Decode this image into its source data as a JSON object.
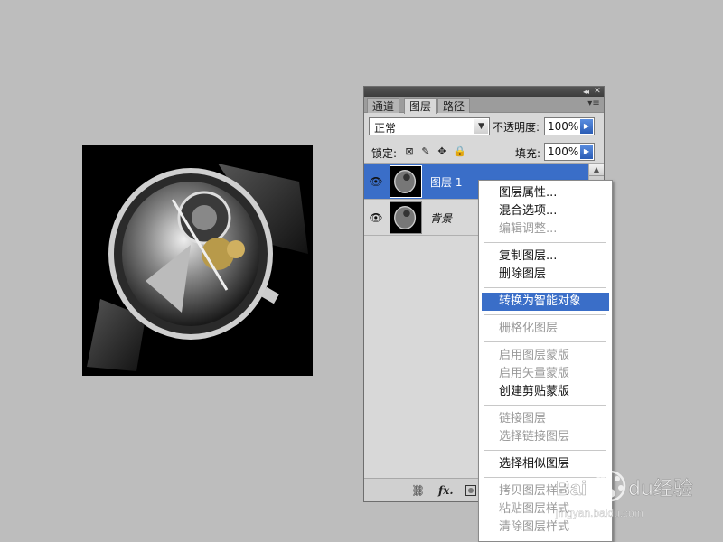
{
  "panel": {
    "collapse_glyph": "◂◂",
    "close_glyph": "✕",
    "tabs": [
      {
        "label": "通道"
      },
      {
        "label": "图层"
      },
      {
        "label": "路径"
      }
    ],
    "menu_icon_glyph": "▾≡",
    "blend_mode": "正常",
    "opacity_label": "不透明度:",
    "opacity_value": "100%",
    "lock_label": "锁定:",
    "fill_label": "填充:",
    "fill_value": "100%",
    "layers": [
      {
        "name": "图层 1",
        "selected": true,
        "visible": true
      },
      {
        "name": "背景",
        "selected": false,
        "visible": true
      }
    ],
    "footer_fx": "fx."
  },
  "context_menu": {
    "items": [
      {
        "label": "图层属性...",
        "enabled": true
      },
      {
        "label": "混合选项...",
        "enabled": true
      },
      {
        "label": "编辑调整...",
        "enabled": false
      },
      {
        "label": "复制图层...",
        "enabled": true
      },
      {
        "label": "删除图层",
        "enabled": true
      },
      {
        "label": "转换为智能对象",
        "enabled": true,
        "highlighted": true
      },
      {
        "label": "栅格化图层",
        "enabled": false
      },
      {
        "label": "启用图层蒙版",
        "enabled": false
      },
      {
        "label": "启用矢量蒙版",
        "enabled": false
      },
      {
        "label": "创建剪贴蒙版",
        "enabled": true
      },
      {
        "label": "链接图层",
        "enabled": false
      },
      {
        "label": "选择链接图层",
        "enabled": false
      },
      {
        "label": "选择相似图层",
        "enabled": true
      },
      {
        "label": "拷贝图层样式",
        "enabled": false
      },
      {
        "label": "粘贴图层样式",
        "enabled": false
      },
      {
        "label": "清除图层样式",
        "enabled": false
      }
    ]
  },
  "watermark": {
    "text": "Baidu经验",
    "url": "jingyan.baidu.com"
  },
  "colors": {
    "selection": "#3a6ec8",
    "background": "#bdbdbd"
  }
}
